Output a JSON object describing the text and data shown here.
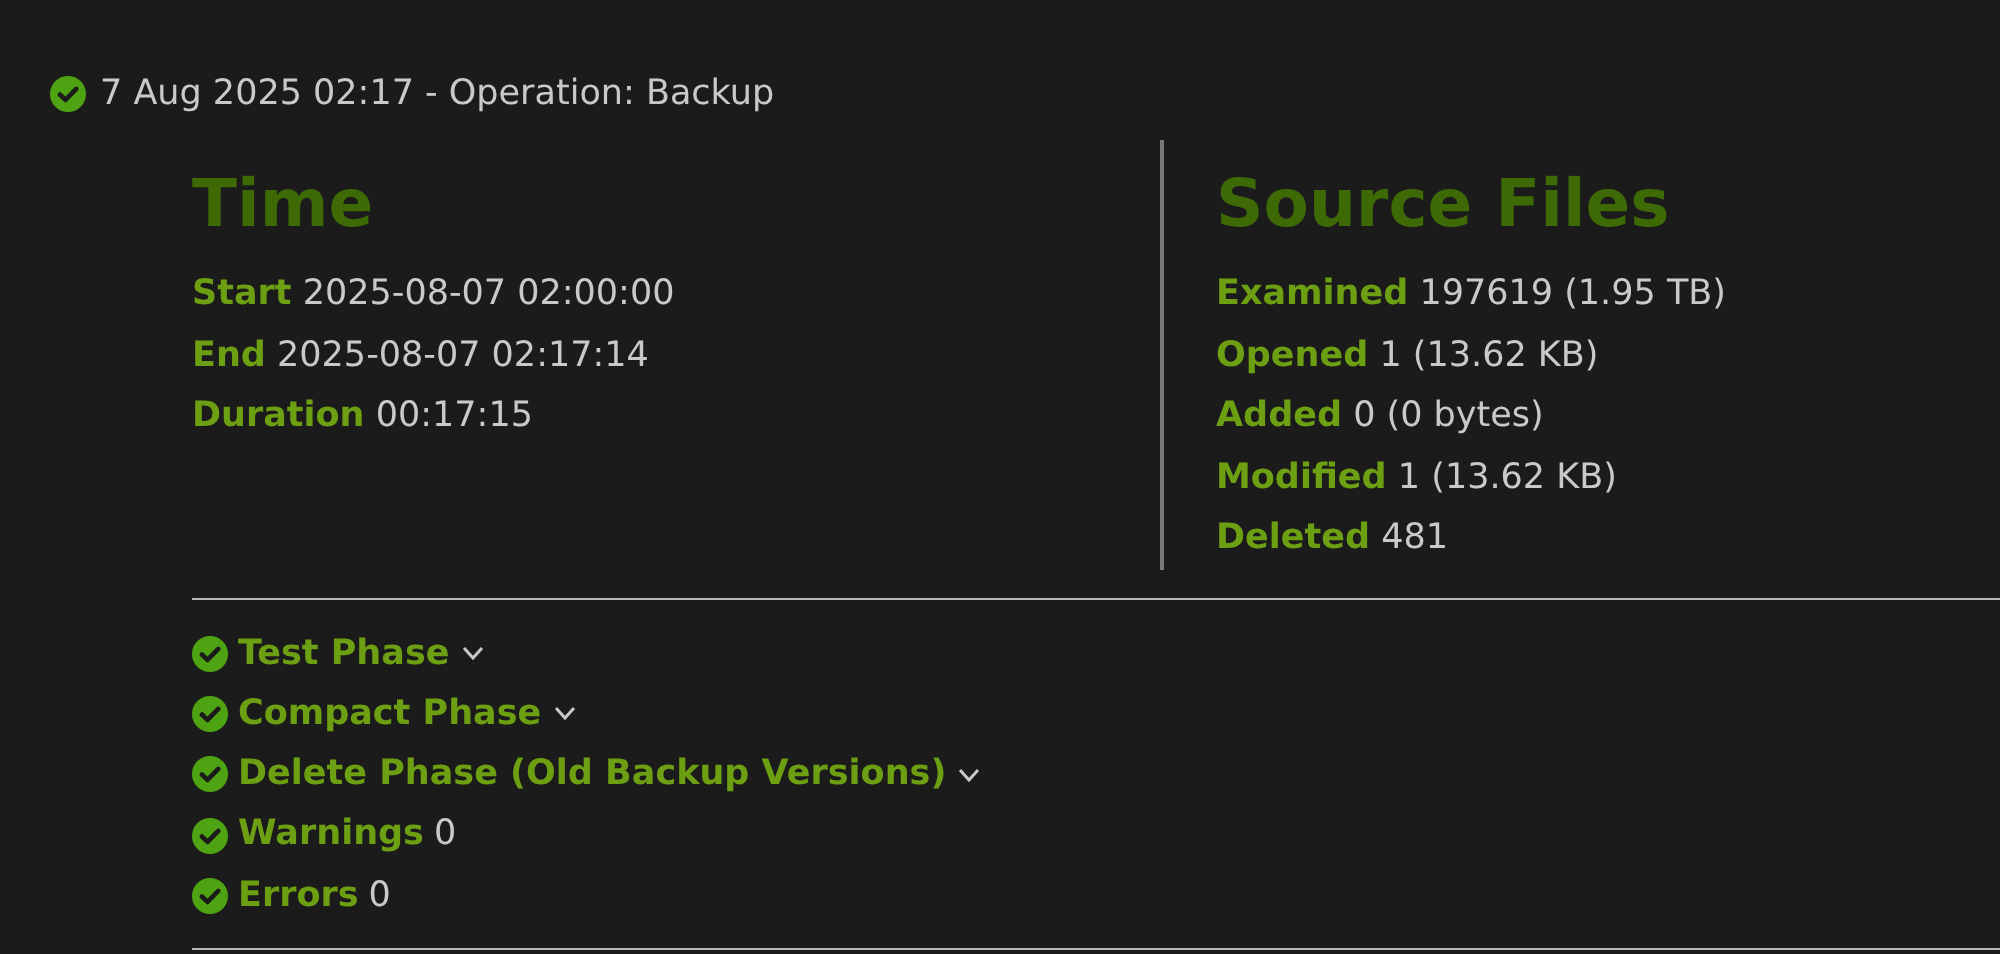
{
  "header": {
    "succeeded": true,
    "title": "7 Aug 2025 02:17 - Operation: Backup"
  },
  "sections": [
    {
      "title": "Time",
      "rows": [
        {
          "label": "Start",
          "value": "2025-08-07 02:00:00"
        },
        {
          "label": "End",
          "value": "2025-08-07 02:17:14"
        },
        {
          "label": "Duration",
          "value": "00:17:15"
        }
      ]
    },
    {
      "title": "Source Files",
      "rows": [
        {
          "label": "Examined",
          "value": "197619 (1.95 TB)"
        },
        {
          "label": "Opened",
          "value": "1 (13.62 KB)"
        },
        {
          "label": "Added",
          "value": "0 (0 bytes)"
        },
        {
          "label": "Modified",
          "value": "1 (13.62 KB)"
        },
        {
          "label": "Deleted",
          "value": "481"
        }
      ]
    }
  ],
  "phases": [
    {
      "kind": "expandable",
      "succeeded": true,
      "label": "Test Phase",
      "expanded": false
    },
    {
      "kind": "expandable",
      "succeeded": true,
      "label": "Compact Phase",
      "expanded": false
    },
    {
      "kind": "expandable",
      "succeeded": true,
      "label": "Delete Phase (Old Backup Versions)",
      "expanded": false
    },
    {
      "kind": "count",
      "succeeded": true,
      "label": "Warnings",
      "value": "0"
    },
    {
      "kind": "count",
      "succeeded": true,
      "label": "Errors",
      "value": "0"
    }
  ]
}
